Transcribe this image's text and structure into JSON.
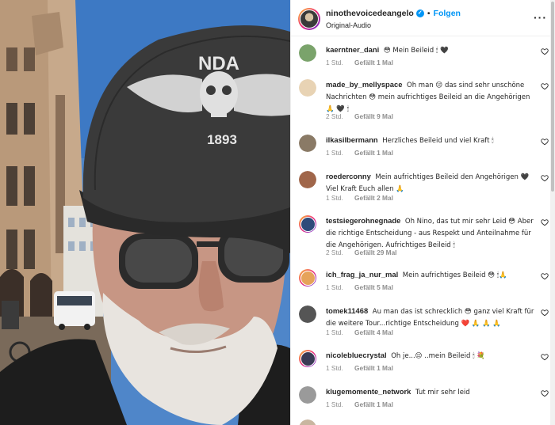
{
  "header": {
    "username": "ninothevoicedeangelo",
    "verified_mark": "✓",
    "separator": "•",
    "follow_label": "Folgen",
    "audio_label": "Original-Audio",
    "more_label": "···"
  },
  "media": {
    "cap_text": "NDA",
    "cap_year": "1893"
  },
  "comments": [
    {
      "user": "kaerntner_dani",
      "text": "😳 Mein Beileid 🕯 🖤",
      "age": "1 Std.",
      "likes": "Gefällt 1 Mal",
      "avatar_color": "#7aa36b"
    },
    {
      "user": "made_by_mellyspace",
      "text": "Oh man 😔 das sind sehr unschöne Nachrichten 😳 mein aufrichtiges Beileid an die Angehörigen 🙏 🖤 🕯",
      "age": "2 Std.",
      "likes": "Gefällt 9 Mal",
      "avatar_color": "#e8d3b4"
    },
    {
      "user": "ilkasilbermann",
      "text": "Herzliches Beileid und viel Kraft 🕯",
      "age": "1 Std.",
      "likes": "Gefällt 1 Mal",
      "avatar_color": "#8a7a66"
    },
    {
      "user": "roederconny",
      "text": "Mein aufrichtiges Beileid den Angehörigen 🖤 Viel Kraft Euch allen 🙏",
      "age": "1 Std.",
      "likes": "Gefällt 2 Mal",
      "avatar_color": "#a0664a"
    },
    {
      "user": "testsiegerohnegnade",
      "text": "Oh Nino, das tut mir sehr Leid 😳 Aber die richtige Entscheidung - aus Respekt und Anteilnahme für die Angehörigen. Aufrichtiges Beileid 🕯",
      "age": "2 Std.",
      "likes": "Gefällt 29 Mal",
      "avatar_color": "#2e4a7a"
    },
    {
      "user": "ich_frag_ja_nur_mal",
      "text": "Mein aufrichtiges Beileid 😳 🕯🙏",
      "age": "1 Std.",
      "likes": "Gefällt 5 Mal",
      "avatar_color": "#e6a35a"
    },
    {
      "user": "tomek11468",
      "text": "Au man das ist schrecklich 😳 ganz viel Kraft für die weitere Tour...richtige Entscheidung ❤️ 🙏 🙏 🙏",
      "age": "1 Std.",
      "likes": "Gefällt 4 Mal",
      "avatar_color": "#555555"
    },
    {
      "user": "nicolebluecrystal",
      "text": "Oh je...😔 ..mein Beileid 🕯 💐",
      "age": "1 Std.",
      "likes": "Gefällt 1 Mal",
      "avatar_color": "#3b3b55"
    },
    {
      "user": "klugemomente_network",
      "text": "Tut mir sehr leid",
      "age": "1 Std.",
      "likes": "Gefällt 1 Mal",
      "avatar_color": "#9a9a9a"
    },
    {
      "user": "",
      "text": "",
      "age": "",
      "likes": "",
      "avatar_color": "#c9b6a0"
    }
  ]
}
